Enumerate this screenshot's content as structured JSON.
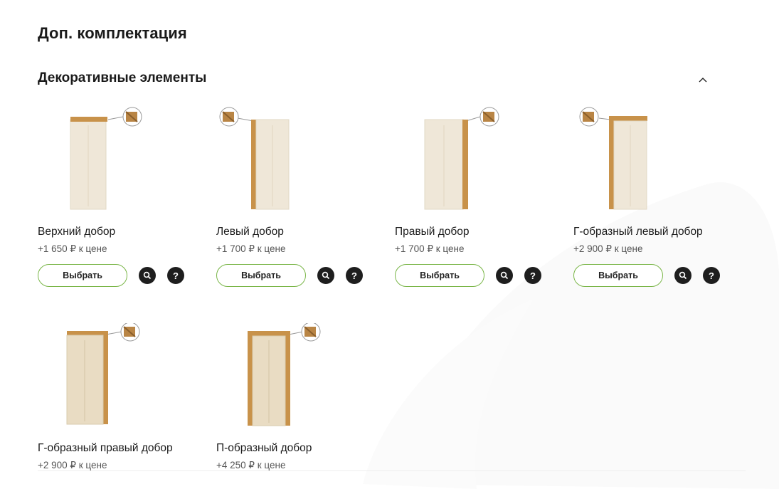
{
  "page": {
    "title": "Доп. комплектация"
  },
  "section": {
    "title": "Декоративные элементы",
    "collapse_icon": "chevron-up-icon"
  },
  "items": [
    {
      "name": "Верхний добор",
      "price": "+1 650 ₽ к цене",
      "select_label": "Выбрать",
      "help_label": "?"
    },
    {
      "name": "Левый добор",
      "price": "+1 700 ₽ к цене",
      "select_label": "Выбрать",
      "help_label": "?"
    },
    {
      "name": "Правый добор",
      "price": "+1 700 ₽ к цене",
      "select_label": "Выбрать",
      "help_label": "?"
    },
    {
      "name": "Г-образный левый добор",
      "price": "+2 900 ₽ к цене",
      "select_label": "Выбрать",
      "help_label": "?"
    },
    {
      "name": "Г-образный правый добор",
      "price": "+2 900 ₽ к цене"
    },
    {
      "name": "П-образный добор",
      "price": "+4 250 ₽ к цене"
    }
  ],
  "colors": {
    "accent": "#7ab648",
    "icon_bg": "#1e1e1e",
    "panel": "#efe6d6",
    "wood": "#c8924a"
  }
}
